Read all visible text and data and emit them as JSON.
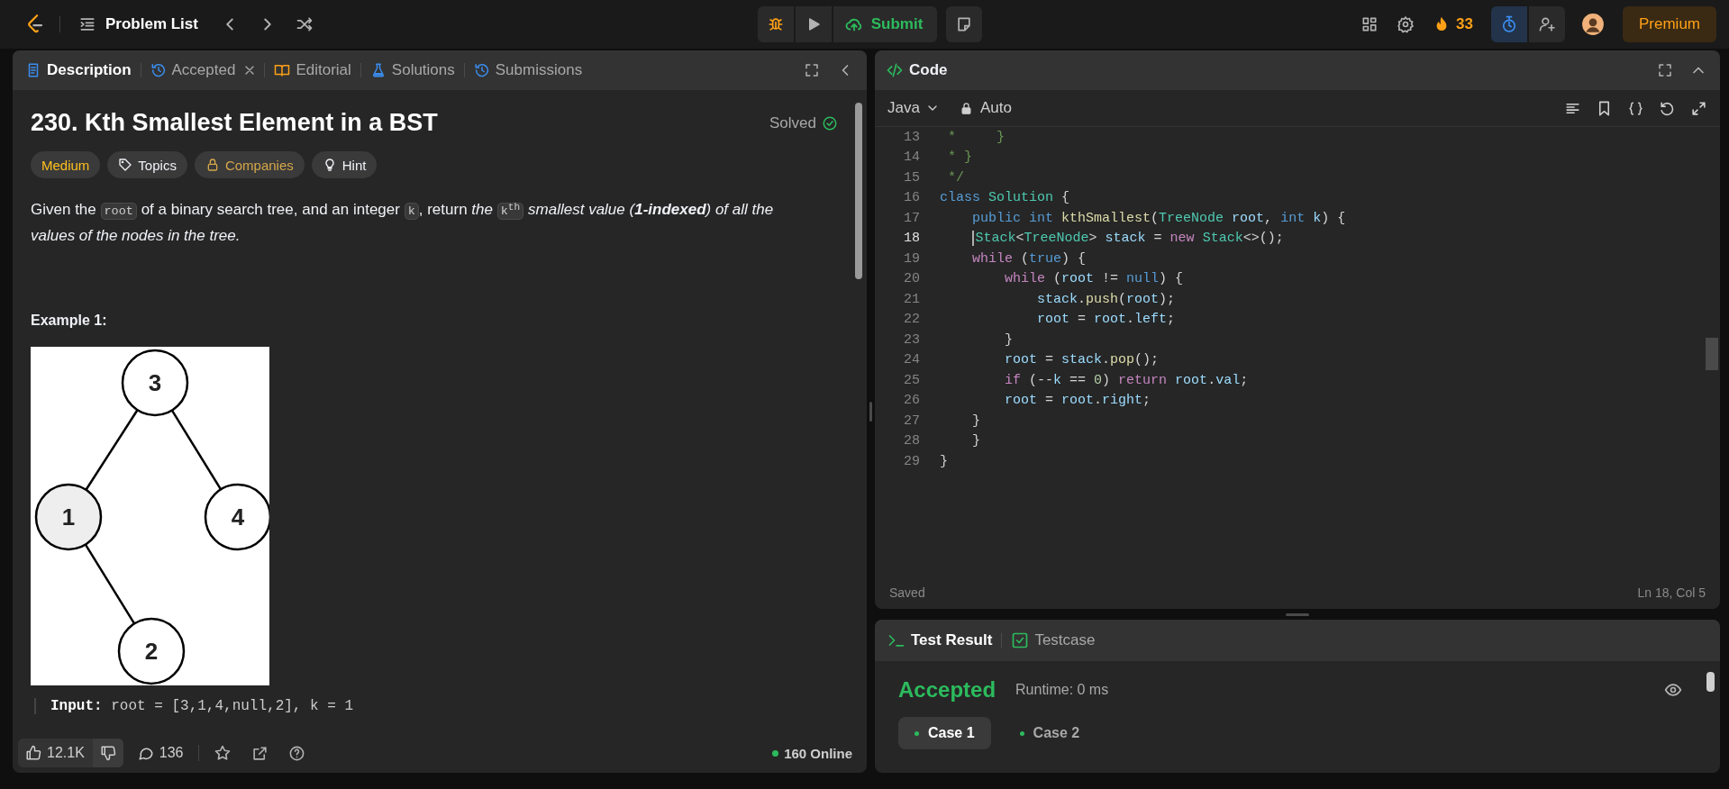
{
  "topbar": {
    "problem_list": "Problem List",
    "submit": "Submit",
    "streak": "33",
    "premium": "Premium"
  },
  "description_panel": {
    "tabs": [
      {
        "label": "Description",
        "kind": "description",
        "selected": true,
        "closable": false
      },
      {
        "label": "Accepted",
        "kind": "accepted",
        "selected": false,
        "closable": true
      },
      {
        "label": "Editorial",
        "kind": "editorial",
        "selected": false,
        "closable": false
      },
      {
        "label": "Solutions",
        "kind": "solutions",
        "selected": false,
        "closable": false
      },
      {
        "label": "Submissions",
        "kind": "submissions",
        "selected": false,
        "closable": false
      }
    ],
    "title": "230. Kth Smallest Element in a BST",
    "status": "Solved",
    "tags": [
      {
        "label": "Medium",
        "kind": "difficulty"
      },
      {
        "label": "Topics",
        "kind": "topics"
      },
      {
        "label": "Companies",
        "kind": "companies"
      },
      {
        "label": "Hint",
        "kind": "hint"
      }
    ],
    "statement": [
      {
        "kind": "plain",
        "text": "Given the "
      },
      {
        "kind": "code",
        "text": "root"
      },
      {
        "kind": "plain",
        "text": " of a binary search tree, and an integer "
      },
      {
        "kind": "code",
        "text": "k"
      },
      {
        "kind": "plain",
        "text": ", return "
      },
      {
        "kind": "italic",
        "text": "the "
      },
      {
        "kind": "code",
        "text": "k$^{th}$"
      },
      {
        "kind": "italic",
        "text": " smallest value ("
      },
      {
        "kind": "strong-italic",
        "text": "1-indexed"
      },
      {
        "kind": "italic",
        "text": ") of all the values of the nodes in the tree."
      }
    ],
    "example_heading": "Example 1:",
    "tree": {
      "label": "3",
      "shaded": false,
      "left": {
        "label": "1",
        "shaded": true,
        "right": {
          "label": "2",
          "shaded": false
        }
      },
      "right": {
        "label": "4",
        "shaded": false
      }
    },
    "example_input": {
      "label": "Input:",
      "value": "root = [3,1,4,null,2], k = 1"
    },
    "footer": {
      "likes": "12.1K",
      "comments": "136",
      "online": "160 Online"
    }
  },
  "code_panel": {
    "title": "Code",
    "language": "Java",
    "mode": "Auto",
    "status": "Saved",
    "cursor": "Ln 18, Col 5",
    "lines": [
      {
        "number": "13",
        "current": false,
        "tokens": [
          {
            "kind": "comment",
            "text": " *     }"
          }
        ]
      },
      {
        "number": "14",
        "current": false,
        "tokens": [
          {
            "kind": "comment",
            "text": " * }"
          }
        ]
      },
      {
        "number": "15",
        "current": false,
        "tokens": [
          {
            "kind": "comment",
            "text": " */"
          }
        ]
      },
      {
        "number": "16",
        "current": false,
        "tokens": [
          {
            "kind": "keyword",
            "text": "class"
          },
          {
            "kind": "type",
            "text": " Solution"
          },
          {
            "kind": "plain",
            "text": " {"
          }
        ]
      },
      {
        "number": "17",
        "current": false,
        "tokens": [
          {
            "kind": "keyword",
            "text": "    public"
          },
          {
            "kind": "keyword",
            "text": " int"
          },
          {
            "kind": "function",
            "text": " kthSmallest"
          },
          {
            "kind": "plain",
            "text": "("
          },
          {
            "kind": "type",
            "text": "TreeNode"
          },
          {
            "kind": "variable",
            "text": " root"
          },
          {
            "kind": "plain",
            "text": ", "
          },
          {
            "kind": "keyword",
            "text": "int"
          },
          {
            "kind": "variable",
            "text": " k"
          },
          {
            "kind": "plain",
            "text": ") {"
          }
        ]
      },
      {
        "number": "18",
        "current": true,
        "tokens": [
          {
            "kind": "type",
            "text": "    Stack"
          },
          {
            "kind": "plain",
            "text": "<"
          },
          {
            "kind": "type",
            "text": "TreeNode"
          },
          {
            "kind": "plain",
            "text": "> "
          },
          {
            "kind": "variable",
            "text": "stack"
          },
          {
            "kind": "plain",
            "text": " = "
          },
          {
            "kind": "control",
            "text": "new"
          },
          {
            "kind": "type",
            "text": " Stack"
          },
          {
            "kind": "plain",
            "text": "<>();"
          }
        ]
      },
      {
        "number": "19",
        "current": false,
        "tokens": [
          {
            "kind": "control",
            "text": "    while"
          },
          {
            "kind": "plain",
            "text": " ("
          },
          {
            "kind": "keyword",
            "text": "true"
          },
          {
            "kind": "plain",
            "text": ") {"
          }
        ]
      },
      {
        "number": "20",
        "current": false,
        "tokens": [
          {
            "kind": "control",
            "text": "        while"
          },
          {
            "kind": "plain",
            "text": " ("
          },
          {
            "kind": "variable",
            "text": "root"
          },
          {
            "kind": "plain",
            "text": " != "
          },
          {
            "kind": "keyword",
            "text": "null"
          },
          {
            "kind": "plain",
            "text": ") {"
          }
        ]
      },
      {
        "number": "21",
        "current": false,
        "tokens": [
          {
            "kind": "variable",
            "text": "            stack"
          },
          {
            "kind": "plain",
            "text": "."
          },
          {
            "kind": "function",
            "text": "push"
          },
          {
            "kind": "plain",
            "text": "("
          },
          {
            "kind": "variable",
            "text": "root"
          },
          {
            "kind": "plain",
            "text": ");"
          }
        ]
      },
      {
        "number": "22",
        "current": false,
        "tokens": [
          {
            "kind": "variable",
            "text": "            root"
          },
          {
            "kind": "plain",
            "text": " = "
          },
          {
            "kind": "variable",
            "text": "root"
          },
          {
            "kind": "plain",
            "text": "."
          },
          {
            "kind": "variable",
            "text": "left"
          },
          {
            "kind": "plain",
            "text": ";"
          }
        ]
      },
      {
        "number": "23",
        "current": false,
        "tokens": [
          {
            "kind": "plain",
            "text": "        }"
          }
        ]
      },
      {
        "number": "24",
        "current": false,
        "tokens": [
          {
            "kind": "variable",
            "text": "        root"
          },
          {
            "kind": "plain",
            "text": " = "
          },
          {
            "kind": "variable",
            "text": "stack"
          },
          {
            "kind": "plain",
            "text": "."
          },
          {
            "kind": "function",
            "text": "pop"
          },
          {
            "kind": "plain",
            "text": "();"
          }
        ]
      },
      {
        "number": "25",
        "current": false,
        "tokens": [
          {
            "kind": "control",
            "text": "        if"
          },
          {
            "kind": "plain",
            "text": " (--"
          },
          {
            "kind": "variable",
            "text": "k"
          },
          {
            "kind": "plain",
            "text": " == "
          },
          {
            "kind": "number",
            "text": "0"
          },
          {
            "kind": "plain",
            "text": ") "
          },
          {
            "kind": "control",
            "text": "return"
          },
          {
            "kind": "variable",
            "text": " root"
          },
          {
            "kind": "plain",
            "text": "."
          },
          {
            "kind": "variable",
            "text": "val"
          },
          {
            "kind": "plain",
            "text": ";"
          }
        ]
      },
      {
        "number": "26",
        "current": false,
        "tokens": [
          {
            "kind": "variable",
            "text": "        root"
          },
          {
            "kind": "plain",
            "text": " = "
          },
          {
            "kind": "variable",
            "text": "root"
          },
          {
            "kind": "plain",
            "text": "."
          },
          {
            "kind": "variable",
            "text": "right"
          },
          {
            "kind": "plain",
            "text": ";"
          }
        ]
      },
      {
        "number": "27",
        "current": false,
        "tokens": [
          {
            "kind": "plain",
            "text": "    }"
          }
        ]
      },
      {
        "number": "28",
        "current": false,
        "tokens": [
          {
            "kind": "plain",
            "text": "    }"
          }
        ]
      },
      {
        "number": "29",
        "current": false,
        "tokens": [
          {
            "kind": "plain",
            "text": "}"
          }
        ]
      }
    ]
  },
  "result_panel": {
    "tabs": [
      {
        "label": "Test Result",
        "kind": "result",
        "selected": true
      },
      {
        "label": "Testcase",
        "kind": "testcase",
        "selected": false
      }
    ],
    "verdict": "Accepted",
    "runtime": "Runtime: 0 ms",
    "cases": [
      {
        "label": "Case 1",
        "selected": true
      },
      {
        "label": "Case 2",
        "selected": false
      }
    ]
  }
}
